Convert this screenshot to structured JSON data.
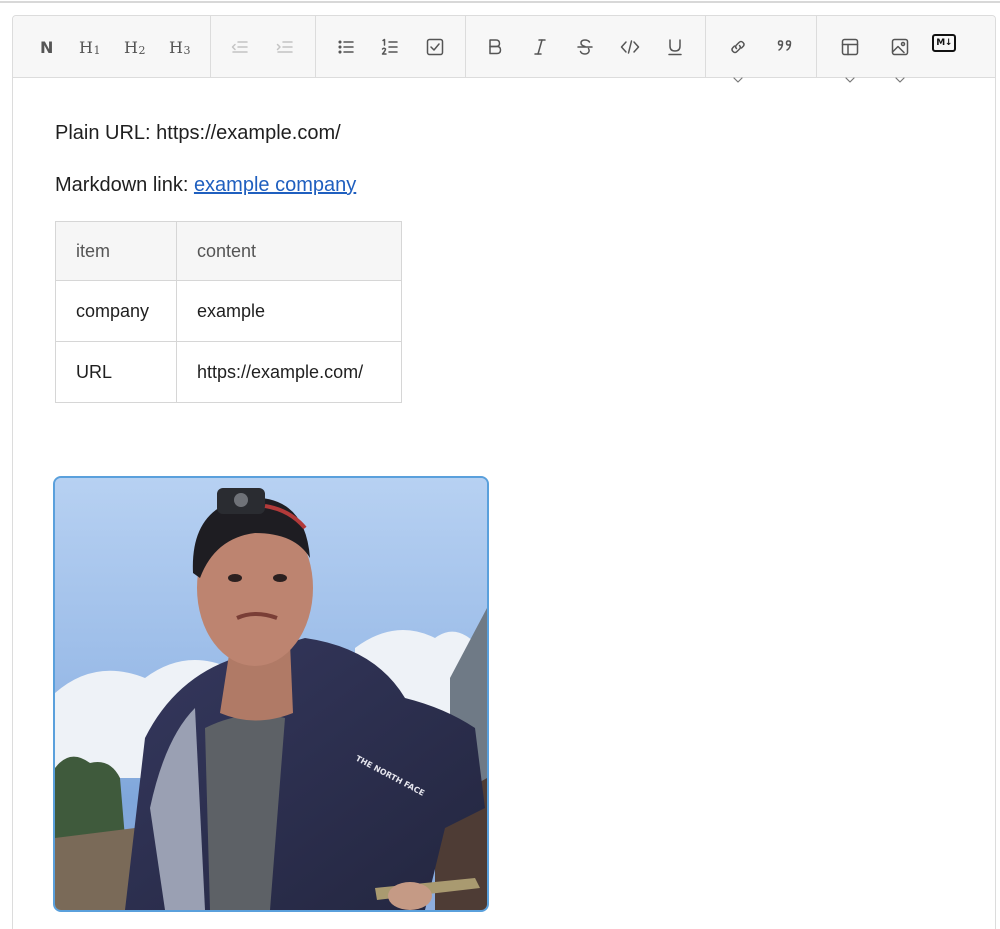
{
  "toolbar": {
    "groups": [
      {
        "id": "headings",
        "buttons": [
          {
            "name": "normal-text",
            "label": "N"
          },
          {
            "name": "heading-1",
            "label": "H",
            "sub": "1"
          },
          {
            "name": "heading-2",
            "label": "H",
            "sub": "2"
          },
          {
            "name": "heading-3",
            "label": "H",
            "sub": "3"
          }
        ]
      },
      {
        "id": "indent",
        "buttons": [
          {
            "name": "outdent",
            "disabled": true
          },
          {
            "name": "indent",
            "disabled": true
          }
        ]
      },
      {
        "id": "lists",
        "buttons": [
          {
            "name": "bullet-list"
          },
          {
            "name": "ordered-list"
          },
          {
            "name": "task-list"
          }
        ]
      },
      {
        "id": "inline",
        "buttons": [
          {
            "name": "bold"
          },
          {
            "name": "italic"
          },
          {
            "name": "strikethrough"
          },
          {
            "name": "code"
          },
          {
            "name": "underline"
          }
        ]
      },
      {
        "id": "insert",
        "buttons": [
          {
            "name": "link",
            "dropdown": true
          },
          {
            "name": "quote"
          }
        ]
      },
      {
        "id": "media",
        "buttons": [
          {
            "name": "table",
            "dropdown": true
          },
          {
            "name": "image",
            "dropdown": true
          },
          {
            "name": "markdown-mode"
          }
        ]
      }
    ],
    "md_badge": "M↓"
  },
  "doc": {
    "plain_url_label": "Plain URL: ",
    "plain_url_value": "https://example.com/",
    "md_link_label": "Markdown link: ",
    "md_link_text": "example company",
    "table": {
      "headers": [
        "item",
        "content"
      ],
      "rows": [
        [
          "company",
          "example"
        ],
        [
          "URL",
          "https://example.com/"
        ]
      ]
    },
    "jacket_logo": "THE NORTH FACE"
  },
  "colors": {
    "link": "#1f5fbf",
    "selection_border": "#5aa0dc",
    "toolbar_bg": "#f7f7f7"
  }
}
